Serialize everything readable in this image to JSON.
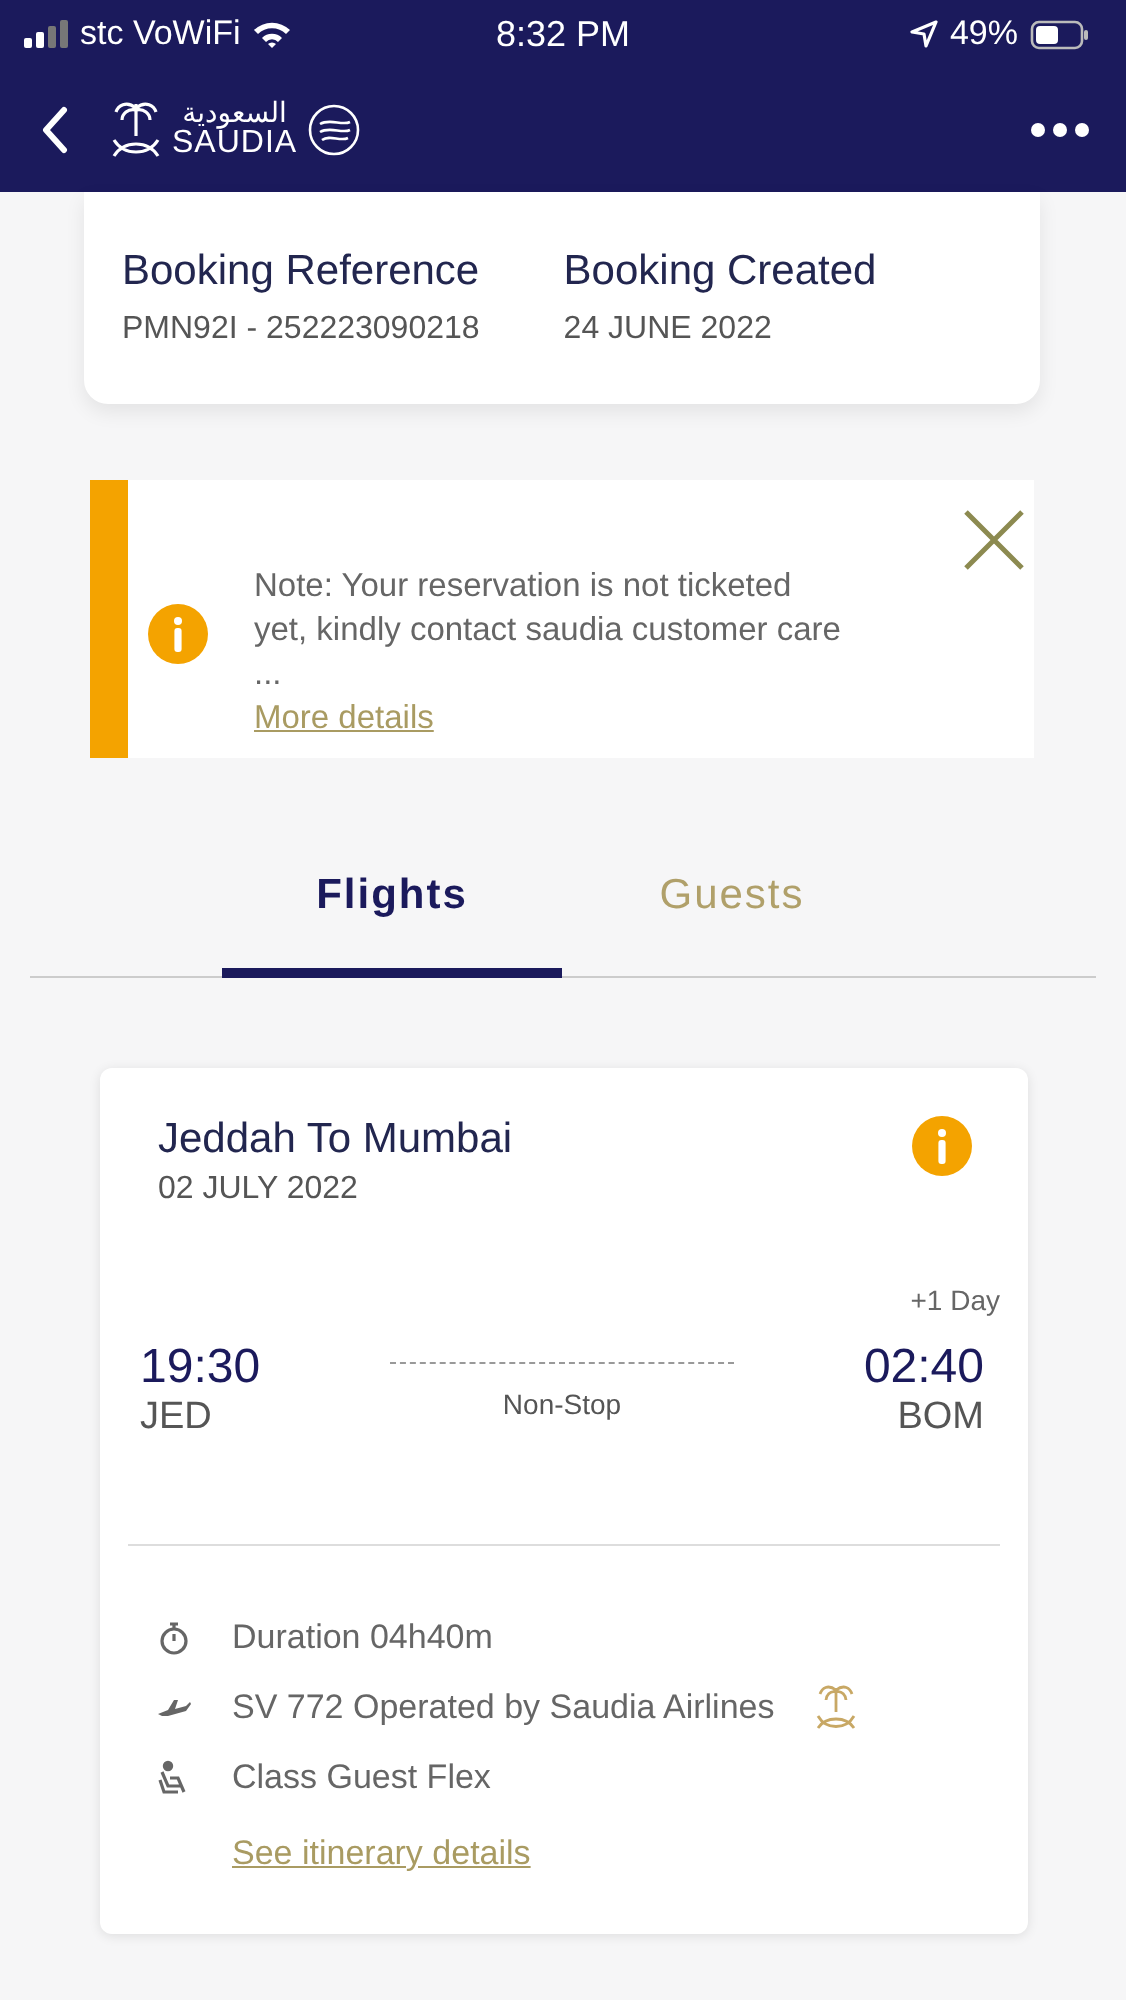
{
  "status_bar": {
    "carrier": "stc VoWiFi",
    "time": "8:32 PM",
    "battery_percent": "49%"
  },
  "header": {
    "logo": {
      "arabic": "السعودية",
      "latin": "SAUDIA"
    }
  },
  "booking": {
    "fields": [
      {
        "label": "Booking Reference",
        "value": "PMN92I - 252223090218"
      },
      {
        "label": "Booking Created",
        "value": "24 JUNE 2022"
      }
    ]
  },
  "notice": {
    "lines": [
      "Note: Your reservation is not ticketed",
      "yet, kindly contact saudia customer care",
      "..."
    ],
    "link": "More details"
  },
  "tabs": [
    {
      "label": "Flights",
      "selected": true
    },
    {
      "label": "Guests",
      "selected": false
    }
  ],
  "flight": {
    "route": "Jeddah To Mumbai",
    "date": "02 JULY 2022",
    "day_offset": "+1 Day",
    "departure": {
      "time": "19:30",
      "airport": "JED"
    },
    "stops": "Non-Stop",
    "arrival": {
      "time": "02:40",
      "airport": "BOM"
    },
    "details": [
      {
        "kind": "duration",
        "text": "Duration 04h40m"
      },
      {
        "kind": "flight",
        "text": "SV 772 Operated by Saudia Airlines"
      },
      {
        "kind": "class",
        "text": "Class Guest Flex"
      }
    ],
    "link": "See itinerary details"
  }
}
